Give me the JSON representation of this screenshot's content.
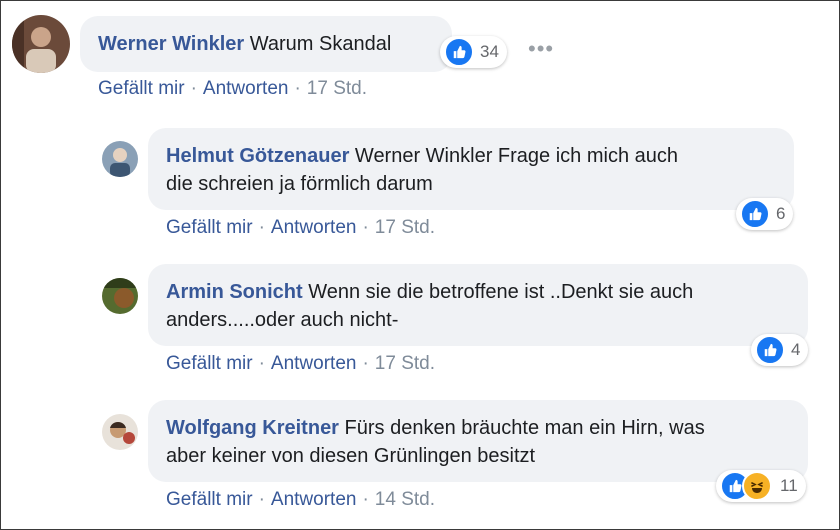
{
  "comments": [
    {
      "author": "Werner Winkler",
      "text": "Warum Skandal",
      "reactions": {
        "count": "34",
        "types": [
          "like-icon"
        ]
      },
      "actions": {
        "like": "Gefällt mir",
        "reply": "Antworten",
        "time": "17 Std."
      },
      "more": "•••"
    },
    {
      "author": "Helmut Götzenauer",
      "text_line1": "Werner Winkler Frage ich mich auch",
      "text_line2": "die schreien ja förmlich darum",
      "reactions": {
        "count": "6",
        "types": [
          "like-icon"
        ]
      },
      "actions": {
        "like": "Gefällt mir",
        "reply": "Antworten",
        "time": "17 Std."
      }
    },
    {
      "author": "Armin Sonicht",
      "text_line1": "Wenn sie die betroffene ist ..Denkt sie auch",
      "text_line2": "anders.....oder auch nicht-",
      "reactions": {
        "count": "4",
        "types": [
          "like-icon"
        ]
      },
      "actions": {
        "like": "Gefällt mir",
        "reply": "Antworten",
        "time": "17 Std."
      }
    },
    {
      "author": "Wolfgang Kreitner",
      "text_line1": "Fürs denken bräuchte man ein Hirn, was",
      "text_line2": "aber keiner von diesen Grünlingen besitzt",
      "reactions": {
        "count": "11",
        "types": [
          "like-icon",
          "haha-icon"
        ]
      },
      "actions": {
        "like": "Gefällt mir",
        "reply": "Antworten",
        "time": "14 Std."
      }
    }
  ],
  "colors": {
    "link": "#385898",
    "bubble": "#f0f2f5",
    "like_blue": "#1877f2",
    "haha_yellow": "#f7b125",
    "meta_gray": "#7f8b99"
  }
}
